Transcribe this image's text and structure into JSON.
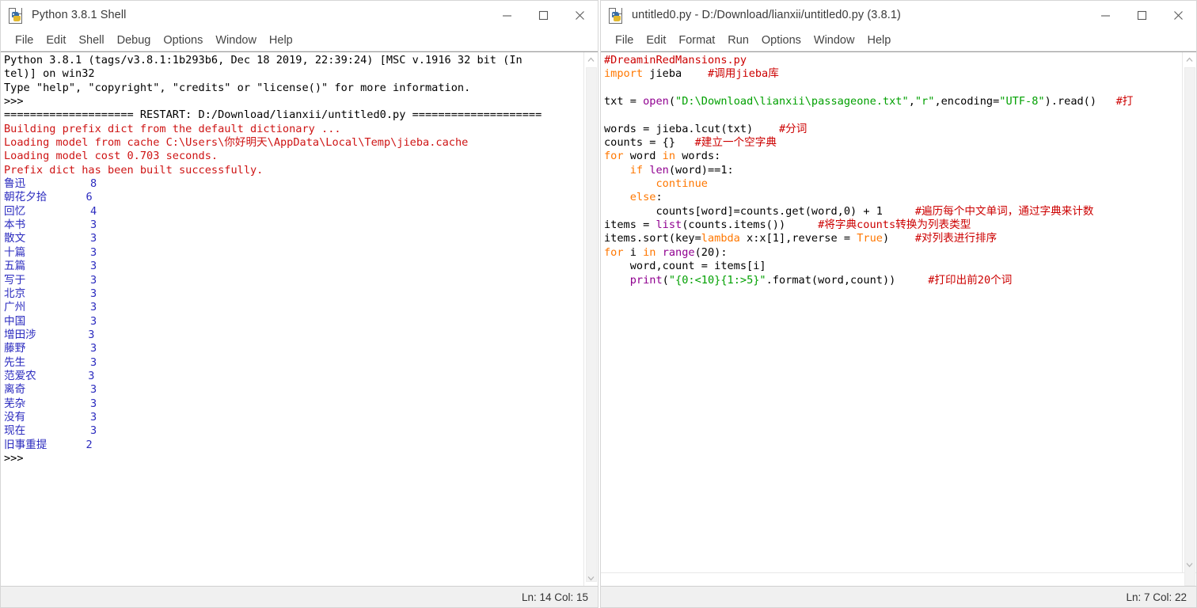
{
  "shell_window": {
    "title": "Python 3.8.1 Shell",
    "icon": "python-idle-icon",
    "controls": {
      "minimize": "minimize-icon",
      "maximize": "maximize-icon",
      "close": "close-icon"
    },
    "menu": [
      "File",
      "Edit",
      "Shell",
      "Debug",
      "Options",
      "Window",
      "Help"
    ],
    "status": "Ln: 14  Col: 15",
    "banner": [
      "Python 3.8.1 (tags/v3.8.1:1b293b6, Dec 18 2019, 22:39:24) [MSC v.1916 32 bit (In",
      "tel)] on win32",
      "Type \"help\", \"copyright\", \"credits\" or \"license()\" for more information.",
      ">>>"
    ],
    "restart_line": "==================== RESTART: D:/Download/lianxii/untitled0.py ====================",
    "stderr_lines": [
      "Building prefix dict from the default dictionary ...",
      "Loading model from cache C:\\Users\\你好明天\\AppData\\Local\\Temp\\jieba.cache",
      "Loading model cost 0.703 seconds.",
      "Prefix dict has been built successfully."
    ],
    "word_counts": [
      {
        "word": "鲁迅",
        "count": "8"
      },
      {
        "word": "朝花夕拾",
        "count": "6"
      },
      {
        "word": "回忆",
        "count": "4"
      },
      {
        "word": "本书",
        "count": "3"
      },
      {
        "word": "散文",
        "count": "3"
      },
      {
        "word": "十篇",
        "count": "3"
      },
      {
        "word": "五篇",
        "count": "3"
      },
      {
        "word": "写于",
        "count": "3"
      },
      {
        "word": "北京",
        "count": "3"
      },
      {
        "word": "广州",
        "count": "3"
      },
      {
        "word": "中国",
        "count": "3"
      },
      {
        "word": "增田涉",
        "count": "3"
      },
      {
        "word": "藤野",
        "count": "3"
      },
      {
        "word": "先生",
        "count": "3"
      },
      {
        "word": "范爱农",
        "count": "3"
      },
      {
        "word": "离奇",
        "count": "3"
      },
      {
        "word": "芜杂",
        "count": "3"
      },
      {
        "word": "没有",
        "count": "3"
      },
      {
        "word": "现在",
        "count": "3"
      },
      {
        "word": "旧事重提",
        "count": "2"
      }
    ],
    "final_prompt": ">>>"
  },
  "editor_window": {
    "title": "untitled0.py - D:/Download/lianxii/untitled0.py (3.8.1)",
    "icon": "python-idle-icon",
    "controls": {
      "minimize": "minimize-icon",
      "maximize": "maximize-icon",
      "close": "close-icon"
    },
    "menu": [
      "File",
      "Edit",
      "Format",
      "Run",
      "Options",
      "Window",
      "Help"
    ],
    "status": "Ln: 7  Col: 22",
    "code_lines": [
      [
        {
          "t": "#DreaminRedMansions.py",
          "c": "cmt"
        }
      ],
      [
        {
          "t": "import",
          "c": "kw"
        },
        {
          "t": " jieba    ",
          "c": "blk"
        },
        {
          "t": "#调用jieba库",
          "c": "cmt"
        }
      ],
      [
        {
          "t": "",
          "c": "blk"
        }
      ],
      [
        {
          "t": "txt = ",
          "c": "blk"
        },
        {
          "t": "open",
          "c": "bi"
        },
        {
          "t": "(",
          "c": "blk"
        },
        {
          "t": "\"D:\\Download\\lianxii\\passageone.txt\"",
          "c": "str"
        },
        {
          "t": ",",
          "c": "blk"
        },
        {
          "t": "\"r\"",
          "c": "str"
        },
        {
          "t": ",encoding=",
          "c": "blk"
        },
        {
          "t": "\"UTF-8\"",
          "c": "str"
        },
        {
          "t": ").read()   ",
          "c": "blk"
        },
        {
          "t": "#打",
          "c": "cmt"
        }
      ],
      [
        {
          "t": "",
          "c": "blk"
        }
      ],
      [
        {
          "t": "words = jieba.lcut(txt)    ",
          "c": "blk"
        },
        {
          "t": "#分词",
          "c": "cmt"
        }
      ],
      [
        {
          "t": "counts = {}   ",
          "c": "blk"
        },
        {
          "t": "#建立一个空字典",
          "c": "cmt"
        }
      ],
      [
        {
          "t": "for",
          "c": "kw"
        },
        {
          "t": " word ",
          "c": "blk"
        },
        {
          "t": "in",
          "c": "kw"
        },
        {
          "t": " words:",
          "c": "blk"
        }
      ],
      [
        {
          "t": "    ",
          "c": "blk"
        },
        {
          "t": "if",
          "c": "kw"
        },
        {
          "t": " ",
          "c": "blk"
        },
        {
          "t": "len",
          "c": "bi"
        },
        {
          "t": "(word)==1:",
          "c": "blk"
        }
      ],
      [
        {
          "t": "        ",
          "c": "blk"
        },
        {
          "t": "continue",
          "c": "kw"
        }
      ],
      [
        {
          "t": "    ",
          "c": "blk"
        },
        {
          "t": "else",
          "c": "kw"
        },
        {
          "t": ":",
          "c": "blk"
        }
      ],
      [
        {
          "t": "        counts[word]=counts.get(word,0) + 1     ",
          "c": "blk"
        },
        {
          "t": "#遍历每个中文单词，通过字典来计数",
          "c": "cmt"
        }
      ],
      [
        {
          "t": "items = ",
          "c": "blk"
        },
        {
          "t": "list",
          "c": "bi"
        },
        {
          "t": "(counts.items())     ",
          "c": "blk"
        },
        {
          "t": "#将字典counts转换为列表类型",
          "c": "cmt"
        }
      ],
      [
        {
          "t": "items.sort(key=",
          "c": "blk"
        },
        {
          "t": "lambda",
          "c": "kw"
        },
        {
          "t": " x:x[1],reverse = ",
          "c": "blk"
        },
        {
          "t": "True",
          "c": "kw"
        },
        {
          "t": ")    ",
          "c": "blk"
        },
        {
          "t": "#对列表进行排序",
          "c": "cmt"
        }
      ],
      [
        {
          "t": "for",
          "c": "kw"
        },
        {
          "t": " i ",
          "c": "blk"
        },
        {
          "t": "in",
          "c": "kw"
        },
        {
          "t": " ",
          "c": "blk"
        },
        {
          "t": "range",
          "c": "bi"
        },
        {
          "t": "(20):",
          "c": "blk"
        }
      ],
      [
        {
          "t": "    word,count = items[i]",
          "c": "blk"
        }
      ],
      [
        {
          "t": "    ",
          "c": "blk"
        },
        {
          "t": "print",
          "c": "bi"
        },
        {
          "t": "(",
          "c": "blk"
        },
        {
          "t": "\"{0:<10}{1:>5}\"",
          "c": "str"
        },
        {
          "t": ".format(word,count))     ",
          "c": "blk"
        },
        {
          "t": "#打印出前20个词",
          "c": "cmt"
        }
      ]
    ]
  }
}
